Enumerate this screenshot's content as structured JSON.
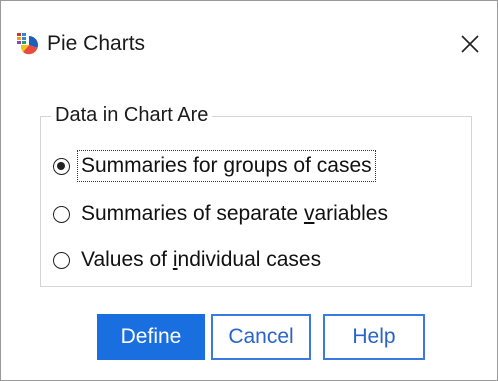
{
  "window": {
    "title": "Pie Charts",
    "icon": "pie-chart-app-icon",
    "close_icon": "close-icon"
  },
  "group": {
    "legend": "Data in Chart Are",
    "options": [
      {
        "pre": "Summaries for ",
        "u": "g",
        "post": "roups of cases",
        "selected": true
      },
      {
        "pre": "Summaries of separate ",
        "u": "v",
        "post": "ariables",
        "selected": false
      },
      {
        "pre": "Values of ",
        "u": "i",
        "post": "ndividual cases",
        "selected": false
      }
    ]
  },
  "buttons": {
    "define": "Define",
    "cancel": "Cancel",
    "help": "Help"
  },
  "colors": {
    "primary": "#1a6fe0",
    "secondary_text": "#2a63c9",
    "secondary_border": "#3b7ae0"
  }
}
